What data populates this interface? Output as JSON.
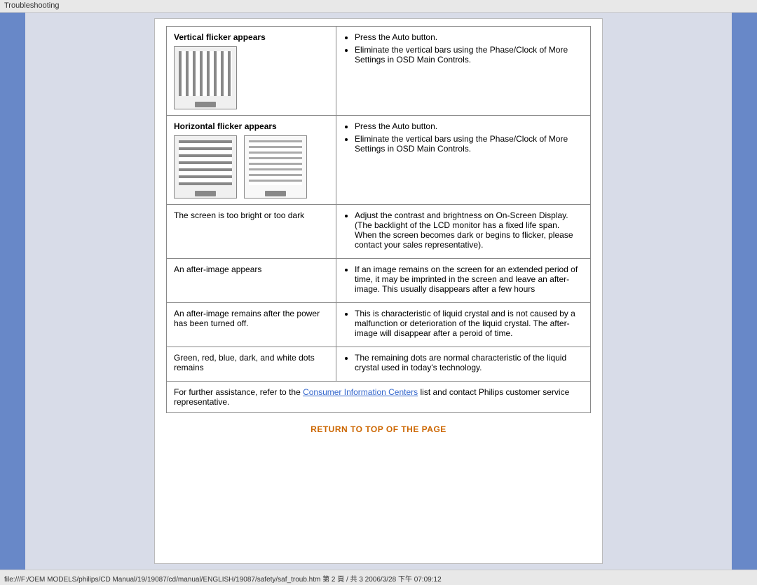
{
  "topbar": {
    "label": "Troubleshooting"
  },
  "footer": {
    "text": "file:///F:/OEM MODELS/philips/CD Manual/19/19087/cd/manual/ENGLISH/19087/safety/saf_troub.htm 第 2 頁 / 共 3 2006/3/28 下午 07:09:12"
  },
  "table": {
    "rows": [
      {
        "id": "vertical-flicker",
        "problem": "Vertical flicker appears",
        "has_image": true,
        "image_type": "vbars",
        "solutions": [
          "Press the Auto button.",
          "Eliminate the vertical bars using the Phase/Clock of More Settings in OSD Main Controls."
        ]
      },
      {
        "id": "horizontal-flicker",
        "problem": "Horizontal flicker appears",
        "has_image": true,
        "image_type": "hbars",
        "image_count": 2,
        "solutions": [
          "Press the Auto button.",
          "Eliminate the vertical bars using the Phase/Clock of More Settings in OSD Main Controls."
        ]
      },
      {
        "id": "brightness",
        "problem": "The screen is too bright or too dark",
        "has_image": false,
        "solutions": [
          "Adjust the contrast and brightness on On-Screen Display. (The backlight of the LCD monitor has a fixed life span. When the screen becomes dark or begins to flicker, please contact your sales representative)."
        ]
      },
      {
        "id": "after-image",
        "problem": "An after-image appears",
        "has_image": false,
        "solutions": [
          "If an image remains on the screen for an extended period of time, it may be imprinted in the screen and leave an after-image. This usually disappears after a few hours"
        ]
      },
      {
        "id": "after-image-power",
        "problem": "An after-image remains after the power has been turned off.",
        "has_image": false,
        "solutions": [
          "This is characteristic of liquid crystal and is not caused by a malfunction or deterioration of the liquid crystal. The after-image will disappear after a peroid of time."
        ]
      },
      {
        "id": "dots",
        "problem": "Green, red, blue, dark, and white dots remains",
        "has_image": false,
        "solutions": [
          "The remaining dots are normal characteristic of the liquid crystal used in today's technology."
        ]
      }
    ],
    "further": {
      "text_before": "For further assistance, refer to the ",
      "link_text": "Consumer Information Centers",
      "text_after": " list and contact Philips customer service representative."
    },
    "return_link": "RETURN TO TOP OF THE PAGE"
  }
}
